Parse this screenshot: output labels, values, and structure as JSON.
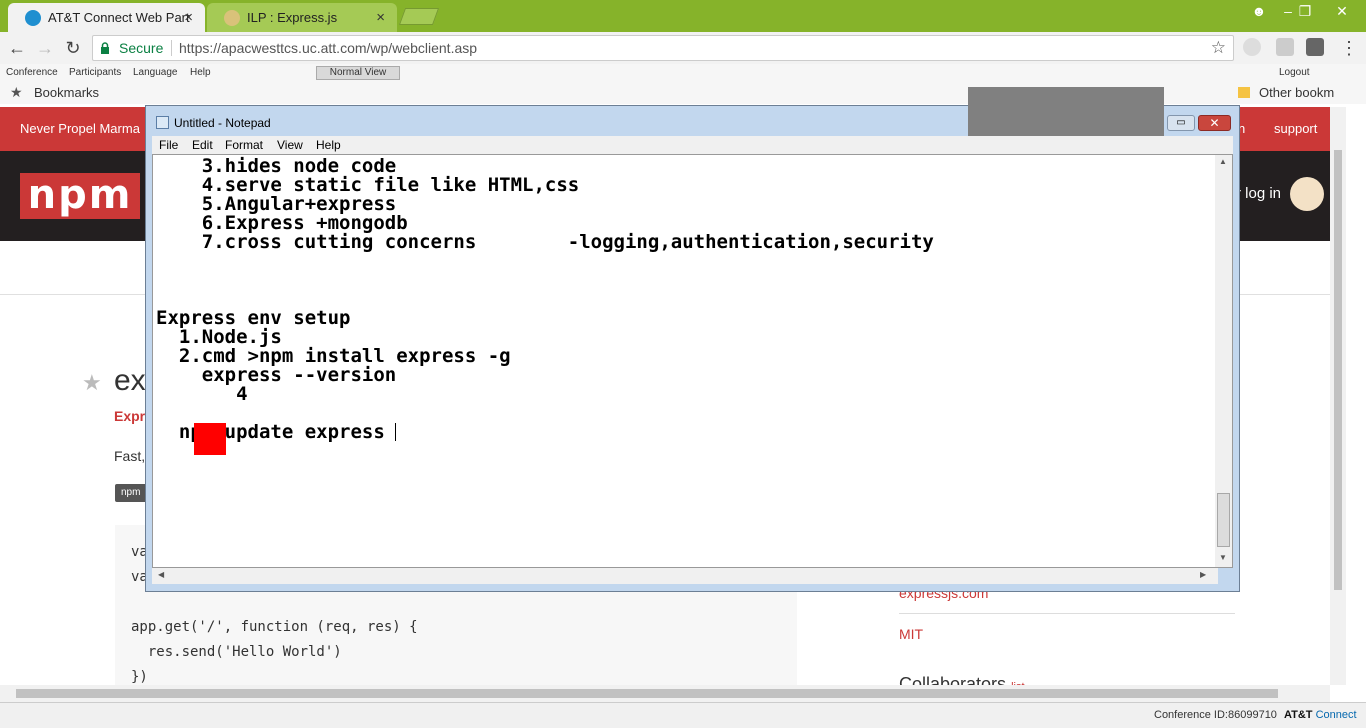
{
  "browser": {
    "tabs": [
      {
        "title": "AT&T Connect Web Part",
        "active": true
      },
      {
        "title": "ILP : Express.js",
        "active": false
      }
    ],
    "close_glyph": "×",
    "secure_label": "Secure",
    "url": "https://apacwesttcs.uc.att.com/wp/webclient.asp",
    "bookmarks_label": "Bookmarks",
    "other_bookmarks_label": "Other bookm"
  },
  "conference_menu": {
    "items": [
      "Conference",
      "Participants",
      "Language",
      "Help"
    ],
    "view_button": "Normal View",
    "logout": "Logout"
  },
  "npm_page": {
    "tagline": "Never Propel Marma",
    "nav_right_1": "n",
    "nav_right_2": "support",
    "logo_text": "npm",
    "login_text": "r log in",
    "package_name": "ex",
    "package_sub": "Expr",
    "package_desc": "Fast,",
    "badge": "npm",
    "code_lines": [
      {
        "text": "va"
      },
      {
        "text": "va"
      },
      {
        "text": ""
      },
      {
        "text": "app.get('/', function (req, res) {"
      },
      {
        "text": "  res.send('Hello World')"
      },
      {
        "text": "})"
      }
    ],
    "homepage_link": "expressjs.com",
    "license": "MIT",
    "collaborators": "Collaborators",
    "collaborators_link": "list"
  },
  "notepad": {
    "title": "Untitled - Notepad",
    "menu": [
      "File",
      "Edit",
      "Format",
      "View",
      "Help"
    ],
    "lines": [
      "    3.hides node code",
      "    4.serve static file like HTML,css",
      "    5.Angular+express",
      "    6.Express +mongodb",
      "    7.cross cutting concerns        -logging,authentication,security",
      "",
      "",
      "",
      "Express env setup",
      "  1.Node.js",
      "  2.cmd >npm install express -g",
      "    express --version",
      "       4",
      "",
      "  npm update express"
    ]
  },
  "status_bar": {
    "conference_id": "Conference ID:86099710",
    "brand_att": "AT&T",
    "brand_connect": "Connect"
  },
  "colors": {
    "tabstrip": "#86b32a",
    "npm_red": "#cb3837",
    "npm_dark": "#231f20",
    "cursor_highlight": "#ff0000"
  }
}
